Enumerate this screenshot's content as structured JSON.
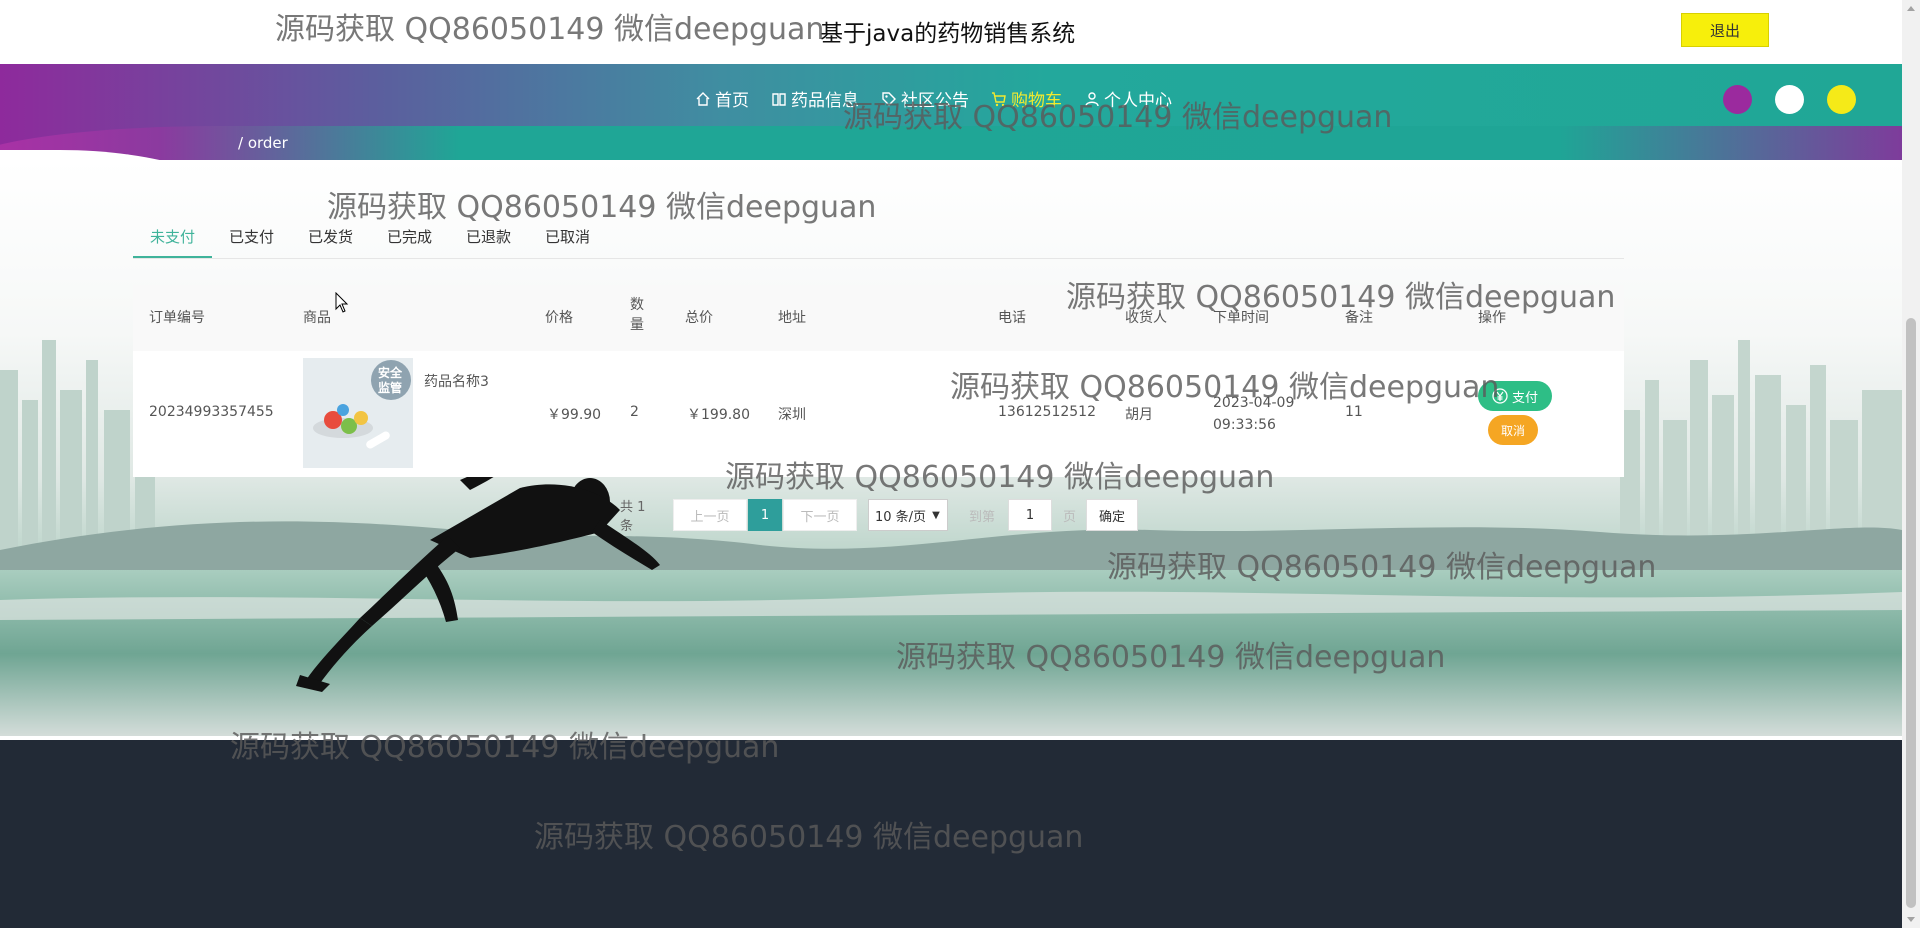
{
  "header": {
    "site_title": "基于java的药物销售系统",
    "logout_label": "退出"
  },
  "nav": {
    "items": [
      {
        "label": "首页",
        "icon": "home-icon"
      },
      {
        "label": "药品信息",
        "icon": "book-icon"
      },
      {
        "label": "社区公告",
        "icon": "tag-icon"
      },
      {
        "label": "购物车",
        "icon": "cart-icon",
        "active": true
      },
      {
        "label": "个人中心",
        "icon": "user-icon"
      }
    ],
    "theme_colors": [
      "#9b2a9e",
      "#ffffff",
      "#f5ea18"
    ],
    "breadcrumb": "/ order"
  },
  "tabs": [
    "未支付",
    "已支付",
    "已发货",
    "已完成",
    "已退款",
    "已取消"
  ],
  "table": {
    "columns": [
      "订单编号",
      "商品",
      "价格",
      "数量",
      "总价",
      "地址",
      "电话",
      "收货人",
      "下单时间",
      "备注",
      "操作"
    ],
    "rows": [
      {
        "order_no": "20234993357455",
        "image_badge": "安全监管",
        "product": "药品名称3",
        "price": "￥99.90",
        "qty": "2",
        "total": "￥199.80",
        "address": "深圳",
        "phone": "13612512512",
        "receiver": "胡月",
        "time": "2023-04-09 09:33:56",
        "remark": "11",
        "pay_label": "支付",
        "cancel_label": "取消"
      }
    ]
  },
  "pagination": {
    "total_text": "共 1 条",
    "prev_label": "上一页",
    "current_page": "1",
    "next_label": "下一页",
    "page_size": "10 条/页",
    "goto_label": "到第",
    "goto_value": "1",
    "page_suffix": "页",
    "confirm_label": "确定"
  },
  "watermark": "源码获取 QQ86050149 微信deepguan"
}
